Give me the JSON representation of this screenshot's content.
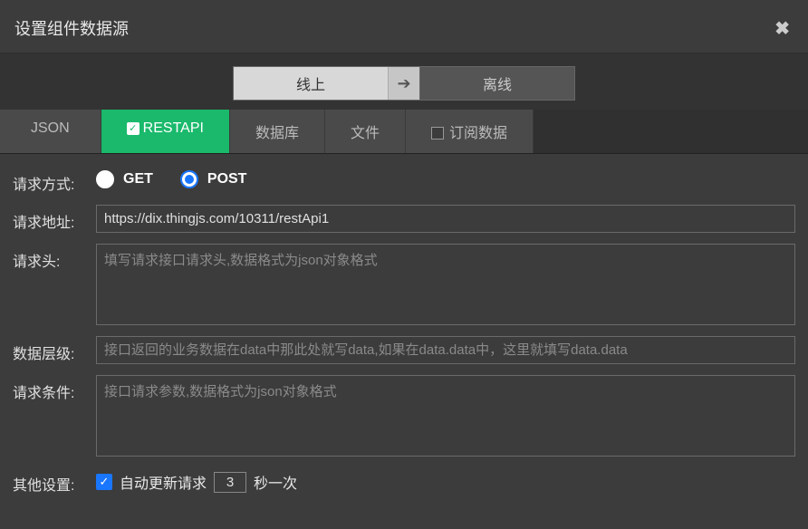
{
  "modal": {
    "title": "设置组件数据源"
  },
  "mode": {
    "online": "线上",
    "offline": "离线"
  },
  "tabs": {
    "json": "JSON",
    "restapi": "RESTAPI",
    "database": "数据库",
    "file": "文件",
    "subscribe": "订阅数据"
  },
  "form": {
    "method_label": "请求方式:",
    "get_label": "GET",
    "post_label": "POST",
    "url_label": "请求地址:",
    "url_value": "https://dix.thingjs.com/10311/restApi1",
    "headers_label": "请求头:",
    "headers_placeholder": "填写请求接口请求头,数据格式为json对象格式",
    "data_level_label": "数据层级:",
    "data_level_placeholder": "接口返回的业务数据在data中那此处就写data,如果在data.data中，这里就填写data.data",
    "conditions_label": "请求条件:",
    "conditions_placeholder": "接口请求参数,数据格式为json对象格式",
    "other_label": "其他设置:",
    "auto_update_label": "自动更新请求",
    "interval_value": "3",
    "interval_suffix": "秒一次"
  }
}
